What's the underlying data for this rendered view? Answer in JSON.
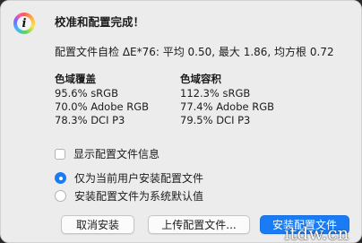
{
  "title": "校准和配置完成！",
  "summary": "配置文件自检 ΔE*76: 平均 0.50, 最大 1.86, 均方根 0.72",
  "gamut_volume": {
    "heading": "色域覆盖",
    "lines": [
      "95.6% sRGB",
      "70.0% Adobe RGB",
      "78.3% DCI P3"
    ]
  },
  "gamut_coverage": {
    "heading": "色域容积",
    "lines": [
      "112.3% sRGB",
      "77.4% Adobe RGB",
      "79.5% DCI P3"
    ]
  },
  "show_profile_info_label": "显示配置文件信息",
  "install_options": {
    "current_user_label": "仅为当前用户安装配置文件",
    "system_default_label": "安装配置文件为系统默认值",
    "selected": "current_user"
  },
  "buttons": {
    "cancel_install": "取消安装",
    "upload_profile": "上传配置文件...",
    "install_profile": "安装配置文件"
  },
  "watermark": "itdw.cn",
  "colors": {
    "accent": "#1a7cf5",
    "background": "#ececec"
  }
}
